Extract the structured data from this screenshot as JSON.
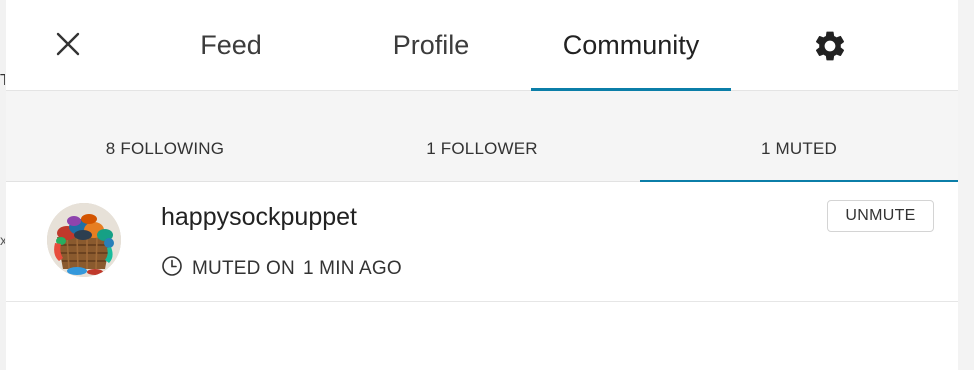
{
  "background_fragments": {
    "top": "T",
    "mid": "x"
  },
  "topnav": {
    "close_icon": "close-icon",
    "tabs": [
      {
        "label": "Feed",
        "active": false
      },
      {
        "label": "Profile",
        "active": false
      },
      {
        "label": "Community",
        "active": true
      }
    ],
    "settings_icon": "gear-icon"
  },
  "subnav": {
    "tabs": [
      {
        "label": "8 FOLLOWING",
        "active": false
      },
      {
        "label": "1 FOLLOWER",
        "active": false
      },
      {
        "label": "1 MUTED",
        "active": true
      }
    ]
  },
  "muted_list": [
    {
      "username": "happysockpuppet",
      "avatar": "basket-of-socks-avatar",
      "status_prefix": "MUTED ON",
      "status_time": "1 MIN AGO",
      "status_icon": "clock-icon",
      "action_label": "UNMUTE"
    }
  ],
  "colors": {
    "accent": "#0b7ea8",
    "subnav_bg": "#f5f5f5",
    "text": "#333333"
  }
}
